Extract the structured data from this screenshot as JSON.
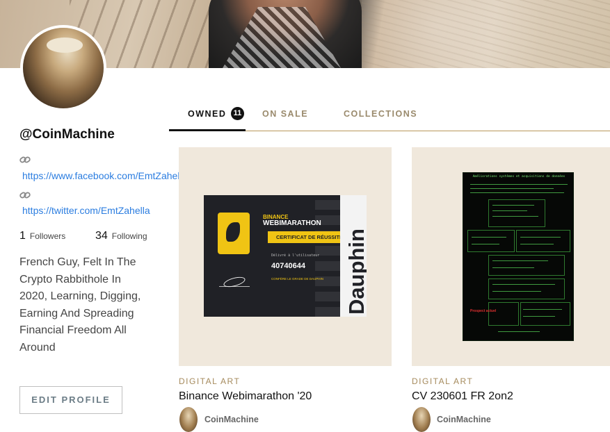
{
  "profile": {
    "username": "@CoinMachine",
    "links": [
      {
        "icon": "link-icon",
        "url": "https://www.facebook.com/EmtZahella"
      },
      {
        "icon": "link-icon",
        "url": "https://twitter.com/EmtZahella"
      }
    ],
    "followers_count": "1",
    "followers_label": "Followers",
    "following_count": "34",
    "following_label": "Following",
    "bio": "French Guy, Felt In The Crypto Rabbithole In 2020, Learning, Digging, Earning And Spreading Financial Freedom All Around",
    "edit_button": "EDIT PROFILE"
  },
  "tabs": [
    {
      "label": "OWNED",
      "count": "11",
      "active": true
    },
    {
      "label": "ON SALE",
      "active": false
    },
    {
      "label": "COLLECTIONS",
      "active": false
    }
  ],
  "cards": [
    {
      "type": "DIGITAL ART",
      "title": "Binance Webimarathon '20",
      "owner": "CoinMachine",
      "art": {
        "brand_top": "BINANCE",
        "brand_main": "WEBIMARATHON",
        "banner": "CERTIFICAT DE RÉUSSITE",
        "delivered": "Délivré à l'utilisateur",
        "user_id": "40740644",
        "grade": "CONFÈRE LE GRADE DE DAUPHIN",
        "vertical": "Dauphin"
      }
    },
    {
      "type": "DIGITAL ART",
      "title": "CV 230601 FR 2on2",
      "owner": "CoinMachine",
      "art": {
        "heading": "Améliorations systèmes et acquisitions de données",
        "red_note": "Prospect actuel"
      }
    }
  ],
  "colors": {
    "accent": "#b8975a",
    "link": "#2b7de0",
    "card_bg": "#f0e8dc",
    "binance_yellow": "#f0c414"
  }
}
